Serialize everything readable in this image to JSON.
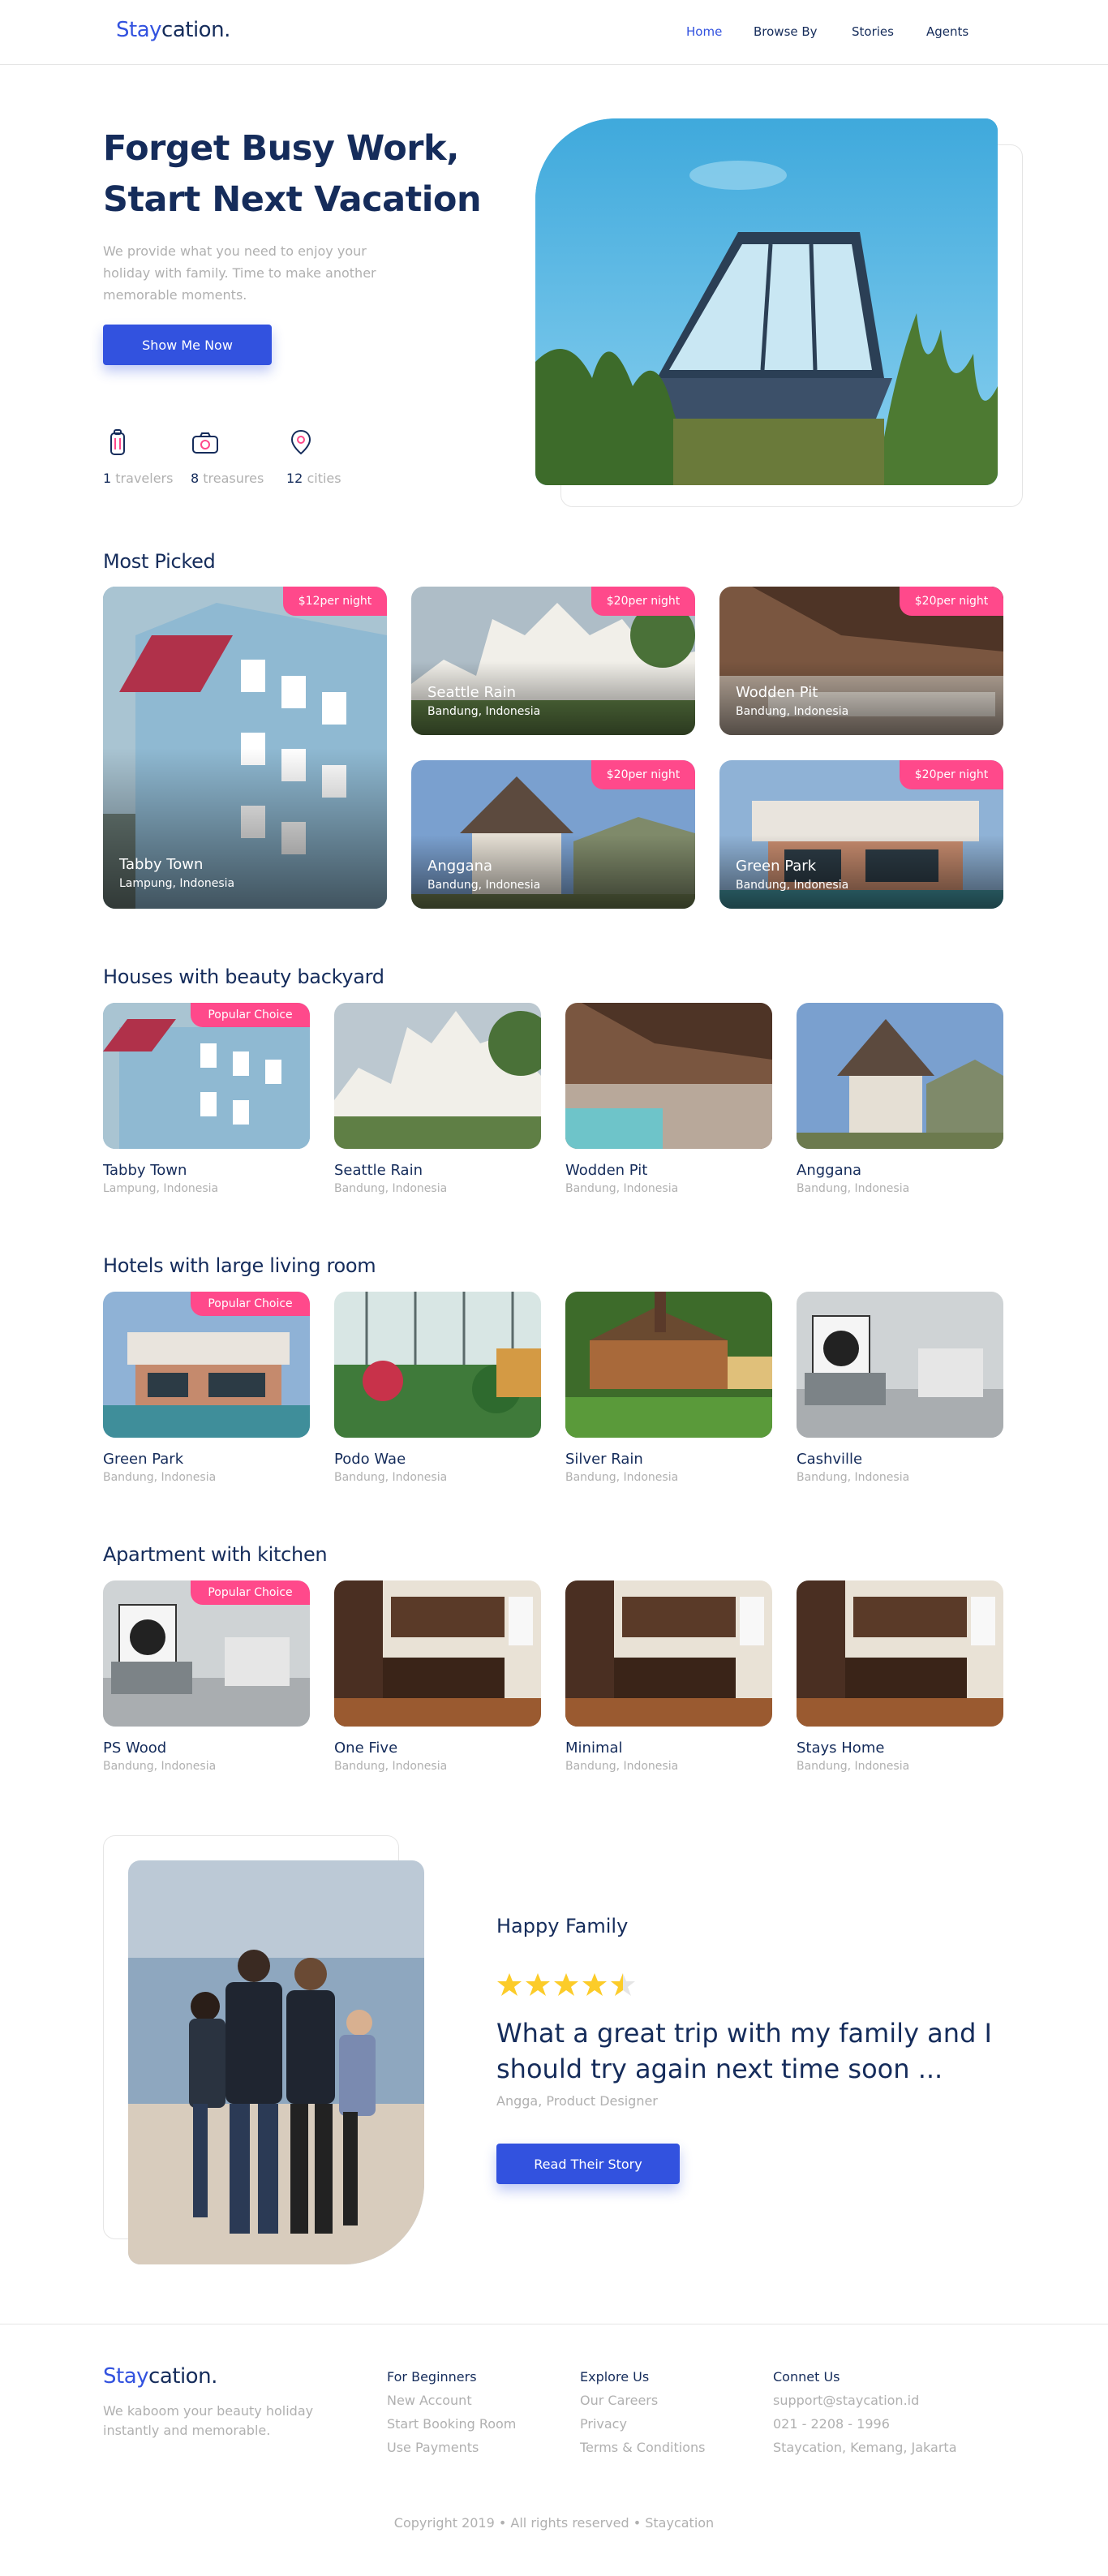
{
  "brand": {
    "part1": "Stay",
    "part2": "cation."
  },
  "nav": [
    "Home",
    "Browse By",
    "Stories",
    "Agents"
  ],
  "hero": {
    "title_line1": "Forget Busy Work,",
    "title_line2": "Start Next Vacation",
    "description": "We provide what you need to enjoy your holiday with family. Time to make another memorable moments.",
    "button": "Show Me Now",
    "stats": [
      {
        "icon": "traveler-icon",
        "count": "1",
        "label": "travelers"
      },
      {
        "icon": "camera-icon",
        "count": "8",
        "label": "treasures"
      },
      {
        "icon": "location-pin-icon",
        "count": "12",
        "label": "cities"
      }
    ]
  },
  "most_picked": {
    "title": "Most Picked",
    "items": [
      {
        "price": "$12",
        "unit": "per night",
        "name": "Tabby Town",
        "location": "Lampung, Indonesia"
      },
      {
        "price": "$20",
        "unit": "per night",
        "name": "Seattle Rain",
        "location": "Bandung, Indonesia"
      },
      {
        "price": "$20",
        "unit": "per night",
        "name": "Wodden Pit",
        "location": "Bandung, Indonesia"
      },
      {
        "price": "$20",
        "unit": "per night",
        "name": "Anggana",
        "location": "Bandung, Indonesia"
      },
      {
        "price": "$20",
        "unit": "per night",
        "name": "Green Park",
        "location": "Bandung, Indonesia"
      }
    ]
  },
  "categories": [
    {
      "title": "Houses with beauty backyard",
      "badge": "Popular Choice",
      "items": [
        {
          "name": "Tabby Town",
          "location": "Lampung, Indonesia"
        },
        {
          "name": "Seattle Rain",
          "location": "Bandung, Indonesia"
        },
        {
          "name": "Wodden Pit",
          "location": "Bandung, Indonesia"
        },
        {
          "name": "Anggana",
          "location": "Bandung, Indonesia"
        }
      ]
    },
    {
      "title": "Hotels with large living room",
      "badge": "Popular Choice",
      "items": [
        {
          "name": "Green Park",
          "location": "Bandung, Indonesia"
        },
        {
          "name": "Podo Wae",
          "location": "Bandung, Indonesia"
        },
        {
          "name": "Silver Rain",
          "location": "Bandung, Indonesia"
        },
        {
          "name": "Cashville",
          "location": "Bandung, Indonesia"
        }
      ]
    },
    {
      "title": "Apartment with kitchen",
      "badge": "Popular Choice",
      "items": [
        {
          "name": "PS Wood",
          "location": "Bandung, Indonesia"
        },
        {
          "name": "One Five",
          "location": "Bandung, Indonesia"
        },
        {
          "name": "Minimal",
          "location": "Bandung, Indonesia"
        },
        {
          "name": "Stays Home",
          "location": "Bandung, Indonesia"
        }
      ]
    }
  ],
  "testimonial": {
    "title": "Happy Family",
    "rating": 4.5,
    "quote": "What a great trip with my family and I should try again next time soon ...",
    "author": "Angga, Product Designer",
    "button": "Read Their Story"
  },
  "footer": {
    "tagline": "We kaboom your beauty holiday instantly and memorable.",
    "columns": [
      {
        "heading": "For Beginners",
        "links": [
          "New Account",
          "Start Booking Room",
          "Use Payments"
        ]
      },
      {
        "heading": "Explore Us",
        "links": [
          "Our Careers",
          "Privacy",
          "Terms & Conditions"
        ]
      },
      {
        "heading": "Connet Us",
        "links": [
          "support@staycation.id",
          "021 - 2208 - 1996",
          "Staycation, Kemang, Jakarta"
        ]
      }
    ],
    "copyright": "Copyright 2019 • All rights reserved • Staycation"
  },
  "colors": {
    "primary": "#3252df",
    "navy": "#152c5b",
    "pink": "#ff498b",
    "gray": "#b0b0b0",
    "star": "#fccc29"
  }
}
